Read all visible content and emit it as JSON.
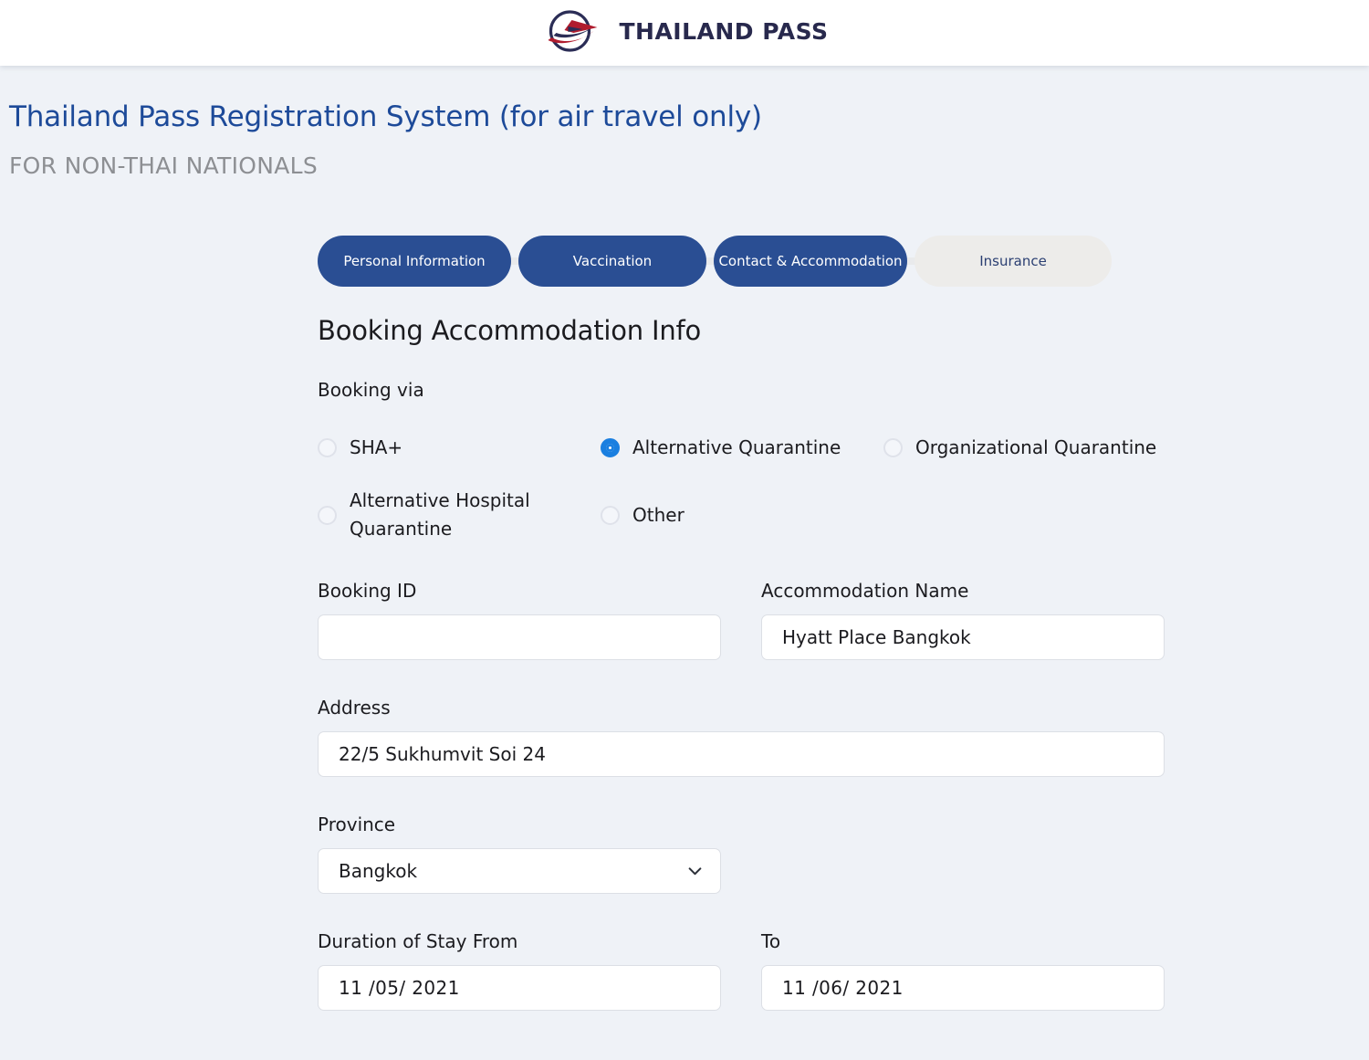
{
  "header": {
    "brand_name": "THAILAND PASS",
    "logo_icon": "thailand-pass-airplane-circle-logo"
  },
  "page": {
    "title": "Thailand Pass Registration System (for air travel only)",
    "subtitle": "FOR NON-THAI NATIONALS"
  },
  "stepper": {
    "steps": [
      {
        "label": "Personal Information",
        "state": "done"
      },
      {
        "label": "Vaccination",
        "state": "done"
      },
      {
        "label": "Contact & Accommodation",
        "state": "done"
      },
      {
        "label": "Insurance",
        "state": "todo"
      }
    ]
  },
  "form": {
    "section_title": "Booking Accommodation Info",
    "booking_via": {
      "label": "Booking via",
      "options": [
        {
          "label": "SHA+",
          "selected": false
        },
        {
          "label": "Alternative Quarantine",
          "selected": true
        },
        {
          "label": "Organizational Quarantine",
          "selected": false
        },
        {
          "label": "Alternative Hospital Quarantine",
          "selected": false
        },
        {
          "label": "Other",
          "selected": false
        }
      ]
    },
    "booking_id": {
      "label": "Booking ID",
      "value": "",
      "placeholder": ""
    },
    "accommodation_name": {
      "label": "Accommodation Name",
      "value": "Hyatt Place Bangkok"
    },
    "address": {
      "label": "Address",
      "value": "22/5 Sukhumvit Soi 24"
    },
    "province": {
      "label": "Province",
      "value": "Bangkok",
      "chevron_icon": "chevron-down-icon"
    },
    "duration_from": {
      "label": "Duration of Stay From",
      "value": "11 /05/ 2021"
    },
    "duration_to": {
      "label": "To",
      "value": "11 /06/ 2021"
    }
  },
  "colors": {
    "brand_navy": "#28294d",
    "step_active": "#2a4e93",
    "step_inactive": "#edecea",
    "title_blue": "#1d4a99",
    "subtitle_gray": "#8d8f93",
    "radio_selected": "#1a7fe0",
    "page_background": "#eff2f7"
  }
}
